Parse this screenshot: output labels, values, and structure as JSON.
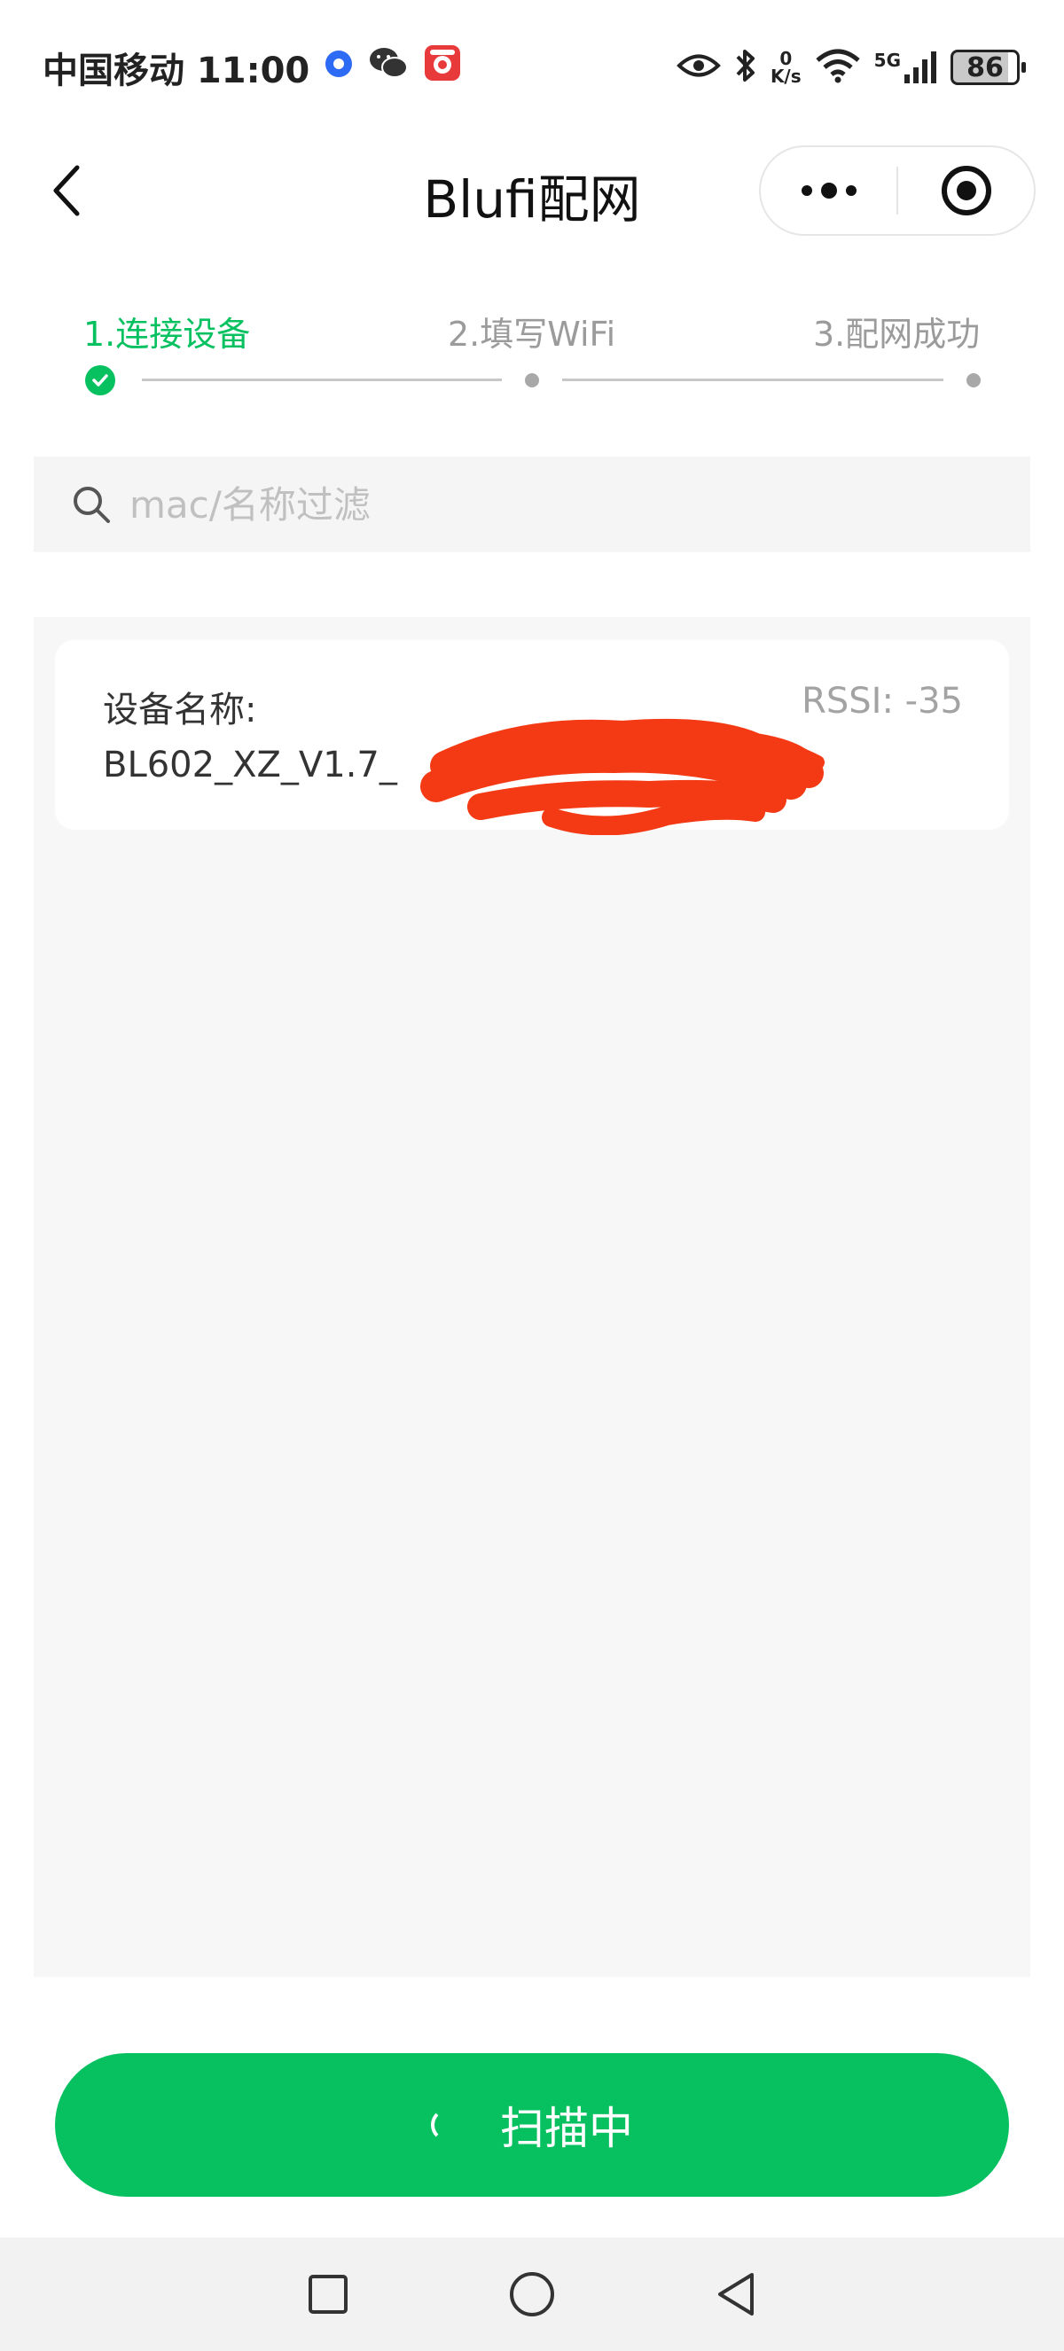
{
  "status_bar": {
    "carrier_time": "中国移动 11:00",
    "netspeed_value": "0",
    "netspeed_unit": "K/s",
    "network_type": "5G",
    "battery": "86"
  },
  "nav": {
    "title": "Blufi配网"
  },
  "steps": [
    {
      "label": "1.连接设备",
      "state": "active"
    },
    {
      "label": "2.填写WiFi",
      "state": "inactive"
    },
    {
      "label": "3.配网成功",
      "state": "inactive"
    }
  ],
  "search": {
    "placeholder": "mac/名称过滤",
    "value": ""
  },
  "devices": [
    {
      "name_label": "设备名称:",
      "name": "BL602_XZ_V1.7_",
      "rssi": "RSSI: -35"
    }
  ],
  "scan_button": {
    "label": "扫描中"
  },
  "colors": {
    "accent": "#07c160",
    "redaction": "#f43a14",
    "list_bg": "#f7f7f8"
  },
  "icons": [
    "back-icon",
    "more-icon",
    "target-icon",
    "check-icon",
    "search-icon",
    "spinner-icon",
    "home-square-icon",
    "home-circle-icon",
    "back-triangle-icon"
  ]
}
